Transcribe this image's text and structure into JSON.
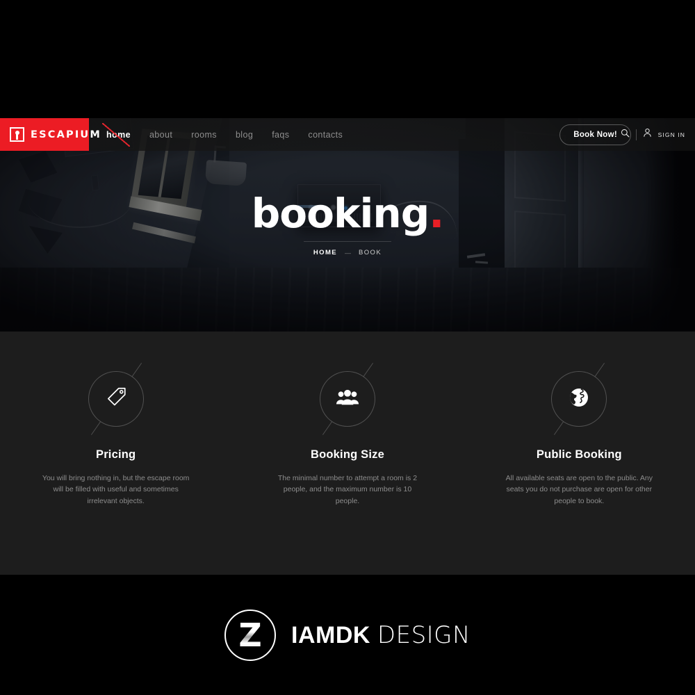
{
  "header": {
    "logo_text": "ESCAPIUM",
    "logo_icon": "keyhole-badge-icon",
    "nav": [
      {
        "label": "home",
        "active": true
      },
      {
        "label": "about",
        "active": false
      },
      {
        "label": "rooms",
        "active": false
      },
      {
        "label": "blog",
        "active": false
      },
      {
        "label": "faqs",
        "active": false
      },
      {
        "label": "contacts",
        "active": false
      }
    ],
    "book_button": "Book Now!",
    "search_icon": "search-icon",
    "user_icon": "user-icon",
    "signin_label": "SIGN IN",
    "accent_color": "#ec1c24",
    "bar_background": "#141414"
  },
  "hero": {
    "title": "booking",
    "title_dot": ".",
    "breadcrumb": {
      "home": "HOME",
      "separator": "—",
      "current": "BOOK"
    },
    "background": "dark abandoned room with window and amplifier"
  },
  "features": {
    "background": "#1d1d1d",
    "items": [
      {
        "icon": "price-tag-icon",
        "title": "Pricing",
        "desc": "You will bring nothing in, but the escape room will be filled with useful and sometimes irrelevant objects."
      },
      {
        "icon": "group-people-icon",
        "title": "Booking Size",
        "desc": "The minimal number to attempt a room is 2 people, and the maximum number is 10 people."
      },
      {
        "icon": "globe-icon",
        "title": "Public Booking",
        "desc": "All available seats are open to the public. Any seats you do not purchase are open for other people to book."
      }
    ]
  },
  "brand_footer": {
    "mark_letter": "Z",
    "name_bold": "IAMDK",
    "name_light": "DESIGN",
    "background": "#000000"
  }
}
